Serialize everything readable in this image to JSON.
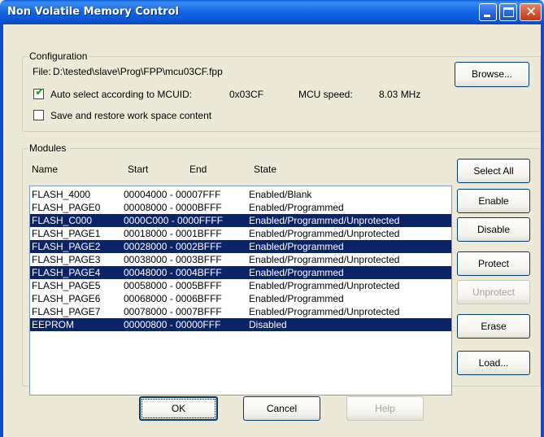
{
  "window": {
    "title": "Non Volatile Memory Control"
  },
  "configuration": {
    "legend": "Configuration",
    "file_label": "File:",
    "file_path": "D:\\tested\\slave\\Prog\\FPP\\mcu03CF.fpp",
    "browse_label": "Browse...",
    "auto_select": {
      "checked": true,
      "label": "Auto select according to MCUID:",
      "mcuid": "0x03CF"
    },
    "mcu_speed_label": "MCU speed:",
    "mcu_speed_value": "8.03 MHz",
    "save_restore": {
      "checked": false,
      "label": "Save and restore work space content"
    }
  },
  "modules": {
    "legend": "Modules",
    "columns": {
      "name": "Name",
      "start": "Start",
      "end": "End",
      "state": "State"
    },
    "rows": [
      {
        "name": "FLASH_4000",
        "range": "00004000 - 00007FFF",
        "state": "Enabled/Blank",
        "selected": false
      },
      {
        "name": "FLASH_PAGE0",
        "range": "00008000 - 0000BFFF",
        "state": "Enabled/Programmed",
        "selected": false
      },
      {
        "name": "FLASH_C000",
        "range": "0000C000 - 0000FFFF",
        "state": "Enabled/Programmed/Unprotected",
        "selected": true
      },
      {
        "name": "FLASH_PAGE1",
        "range": "00018000 - 0001BFFF",
        "state": "Enabled/Programmed/Unprotected",
        "selected": false
      },
      {
        "name": "FLASH_PAGE2",
        "range": "00028000 - 0002BFFF",
        "state": "Enabled/Programmed",
        "selected": true
      },
      {
        "name": "FLASH_PAGE3",
        "range": "00038000 - 0003BFFF",
        "state": "Enabled/Programmed/Unprotected",
        "selected": false
      },
      {
        "name": "FLASH_PAGE4",
        "range": "00048000 - 0004BFFF",
        "state": "Enabled/Programmed",
        "selected": true
      },
      {
        "name": "FLASH_PAGE5",
        "range": "00058000 - 0005BFFF",
        "state": "Enabled/Programmed/Unprotected",
        "selected": false
      },
      {
        "name": "FLASH_PAGE6",
        "range": "00068000 - 0006BFFF",
        "state": "Enabled/Programmed",
        "selected": false
      },
      {
        "name": "FLASH_PAGE7",
        "range": "00078000 - 0007BFFF",
        "state": "Enabled/Programmed/Unprotected",
        "selected": false
      },
      {
        "name": "EEPROM",
        "range": "00000800 - 00000FFF",
        "state": "Disabled",
        "selected": true
      }
    ],
    "buttons": {
      "select_all": "Select All",
      "enable": "Enable",
      "disable": "Disable",
      "protect": "Protect",
      "unprotect": "Unprotect",
      "erase": "Erase",
      "load": "Load..."
    }
  },
  "footer": {
    "ok": "OK",
    "cancel": "Cancel",
    "help": "Help"
  }
}
